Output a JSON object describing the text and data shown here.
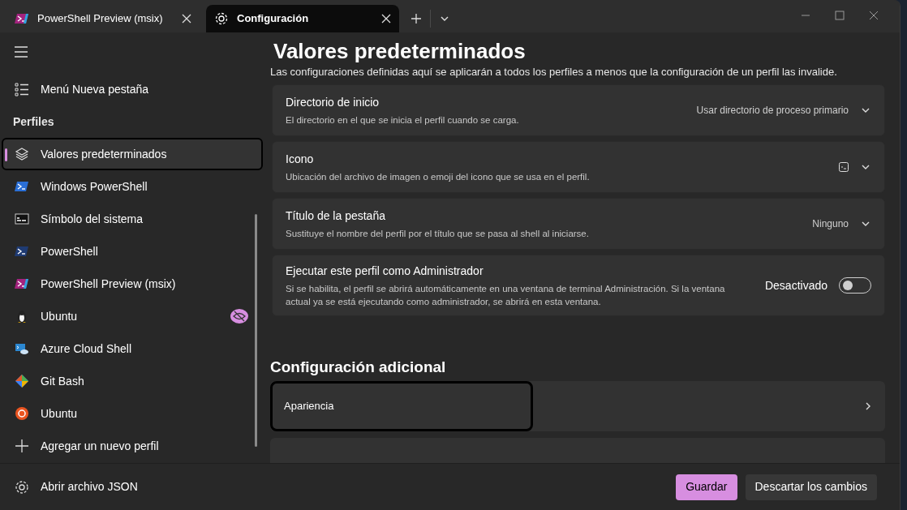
{
  "tabs": [
    {
      "title": "PowerShell Preview (msix)",
      "selected": false
    },
    {
      "title": "Configuración",
      "selected": true
    }
  ],
  "sidebar": {
    "top_item": "Menú Nueva pestaña",
    "section": "Perfiles",
    "profiles": [
      {
        "label": "Valores predeterminados",
        "selected": true,
        "hidden": false
      },
      {
        "label": "Windows PowerShell",
        "selected": false,
        "hidden": false
      },
      {
        "label": "Símbolo del sistema",
        "selected": false,
        "hidden": false
      },
      {
        "label": "PowerShell",
        "selected": false,
        "hidden": false
      },
      {
        "label": "PowerShell Preview (msix)",
        "selected": false,
        "hidden": false
      },
      {
        "label": "Ubuntu",
        "selected": false,
        "hidden": true
      },
      {
        "label": "Azure Cloud Shell",
        "selected": false,
        "hidden": false
      },
      {
        "label": "Git Bash",
        "selected": false,
        "hidden": false
      },
      {
        "label": "Ubuntu",
        "selected": false,
        "hidden": false
      }
    ],
    "add_item": "Agregar un nuevo perfil",
    "footer_item": "Abrir archivo JSON"
  },
  "page": {
    "title": "Valores predeterminados",
    "subtitle": "Las configuraciones definidas aquí se aplicarán a todos los perfiles a menos que la configuración de un perfil las invalide.",
    "settings": [
      {
        "kind": "dropdown",
        "title": "Directorio de inicio",
        "description": "El directorio en el que se inicia el perfil cuando se carga.",
        "value": "Usar directorio de proceso primario"
      },
      {
        "kind": "icon",
        "title": "Icono",
        "description": "Ubicación del archivo de imagen o emoji del icono que se usa en el perfil."
      },
      {
        "kind": "dropdown",
        "title": "Título de la pestaña",
        "description": "Sustituye el nombre del perfil por el título que se pasa al shell al iniciarse.",
        "value": "Ninguno"
      },
      {
        "kind": "toggle",
        "title": "Ejecutar este perfil como Administrador",
        "description": "Si se habilita, el perfil se abrirá automáticamente en una ventana de terminal Administración. Si la ventana actual ya se está ejecutando como administrador, se abrirá en esta ventana.",
        "value": "Desactivado",
        "on": false
      }
    ],
    "section": "Configuración adicional",
    "links": [
      {
        "title": "Apariencia"
      }
    ]
  },
  "buttons": [
    "Guardar",
    "Descartar los cambios"
  ]
}
